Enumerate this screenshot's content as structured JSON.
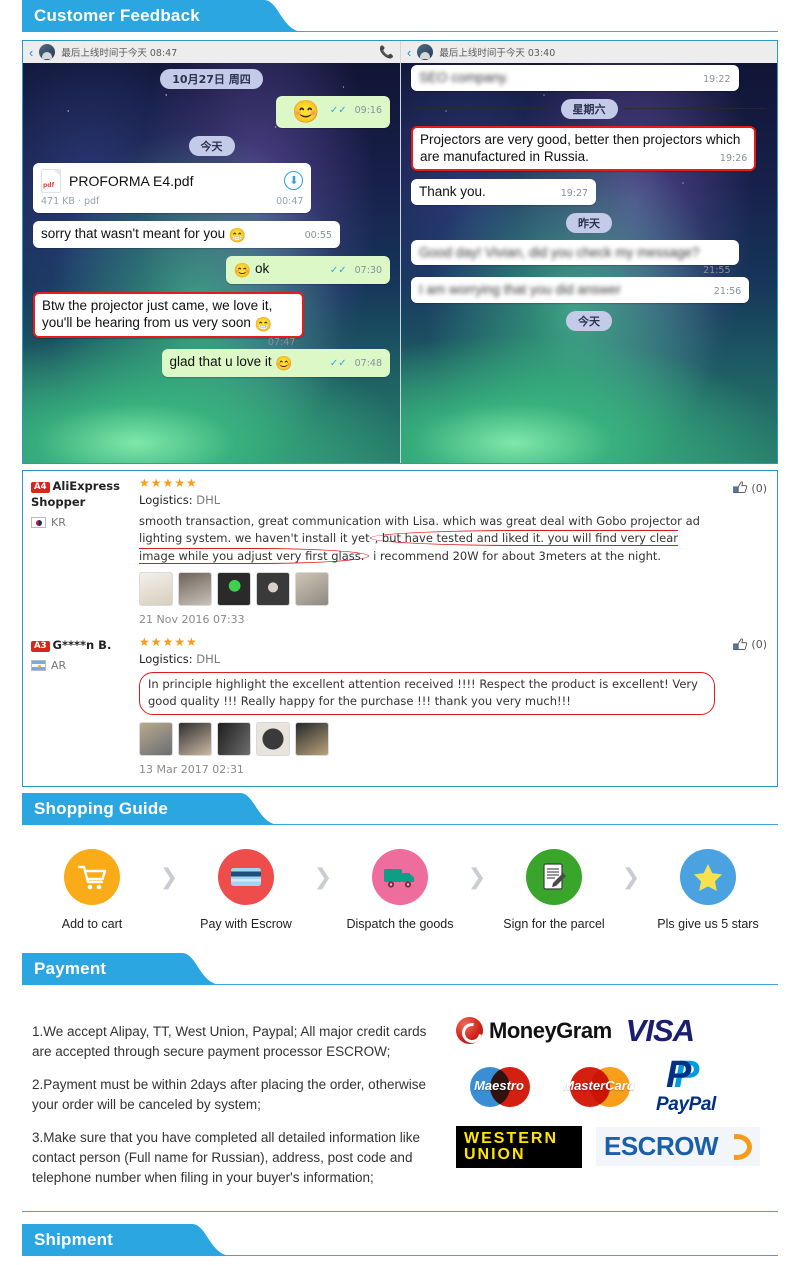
{
  "sections": {
    "customer_feedback": "Customer Feedback",
    "shopping_guide": "Shopping Guide",
    "payment": "Payment",
    "shipment": "Shipment"
  },
  "colors": {
    "banner_blue": "#2ba6e0",
    "border_blue": "#2a9ac4",
    "highlight_red": "#e01b1b",
    "star_orange": "#f79d16"
  },
  "chat": {
    "left": {
      "status": "最后上线时间于今天 08:47",
      "daypills": [
        "10月27日 周四",
        "今天"
      ],
      "messages": [
        {
          "side": "out",
          "text": "",
          "emoji": "😊",
          "time": "09:16",
          "ticks": "✓✓"
        },
        {
          "side": "in",
          "type": "file",
          "filename": "PROFORMA E4.pdf",
          "filemeta": "471 KB · pdf",
          "time": "00:47",
          "icon": "pdf-icon",
          "download": "download-icon"
        },
        {
          "side": "in",
          "text": "sorry that wasn't meant for you",
          "emoji": "😁",
          "time": "00:55"
        },
        {
          "side": "out",
          "text": "ok",
          "emoji": "😊",
          "time": "07:30",
          "ticks": "✓✓"
        },
        {
          "side": "in",
          "text": "Btw the projector just came, we love it, you'll be hearing from us very soon",
          "emoji": "😁",
          "time": "07:47",
          "highlight": true
        },
        {
          "side": "out",
          "text": "glad that u love it",
          "emoji": "😊",
          "time": "07:48",
          "ticks": "✓✓"
        }
      ]
    },
    "right": {
      "status": "最后上线时间于今天 03:40",
      "messages": [
        {
          "side": "in",
          "text": "SEO company.",
          "time": "19:22",
          "blurred": true
        },
        {
          "side": "divider",
          "text": "星期六"
        },
        {
          "side": "in",
          "text": "Projectors  are very good, better then projectors which are manufactured in Russia.",
          "time": "19:26",
          "highlight": true
        },
        {
          "side": "in",
          "text": "Thank you.",
          "time": "19:27"
        },
        {
          "side": "daypill",
          "text": "昨天"
        },
        {
          "side": "in",
          "text": "Good day! Vivian, did you check my message?",
          "time": "21:55",
          "blurred": true
        },
        {
          "side": "in",
          "text": "I am worrying that you did answer",
          "time": "21:56",
          "blurred": true
        },
        {
          "side": "daypill",
          "text": "今天"
        }
      ]
    }
  },
  "reviews": [
    {
      "badge": "A4",
      "name": "AliExpress Shopper",
      "country": "KR",
      "flag": "flag-kr-icon",
      "stars": "★★★★★",
      "logistics_label": "Logistics:",
      "logistics_value": "DHL",
      "text": "smooth transaction, great communication with Lisa. which was great deal with Gobo projector ad lighting system. we haven't install it yet, but have tested and liked it. you will find very clear image while you adjust very first glass. i recommend 20W for about 3meters at the night.",
      "highlight_phrase": ", but have tested and liked it. you will find very clear image while you adjust very first glass.",
      "date": "21 Nov 2016 07:33",
      "likes": "(0)",
      "like_icon": "thumbs-up-icon",
      "thumb_count": 5
    },
    {
      "badge": "A3",
      "name": "G****n B.",
      "country": "AR",
      "flag": "flag-ar-icon",
      "stars": "★★★★★",
      "logistics_label": "Logistics:",
      "logistics_value": "DHL",
      "text": "In principle highlight the excellent attention received !!!! Respect the product is excellent! Very good quality !!! Really happy for the purchase !!! thank you very much!!!",
      "date": "13 Mar 2017 02:31",
      "likes": "(0)",
      "like_icon": "thumbs-up-icon",
      "thumb_count": 5
    }
  ],
  "guide_steps": [
    {
      "label": "Add to cart",
      "icon": "shopping-cart-icon",
      "color": "#f9ac18"
    },
    {
      "label": "Pay with Escrow",
      "icon": "credit-card-icon",
      "color": "#ef4c4c"
    },
    {
      "label": "Dispatch the goods",
      "icon": "delivery-truck-icon",
      "color": "#ef6d9c"
    },
    {
      "label": "Sign for the parcel",
      "icon": "sign-document-icon",
      "color": "#3aa52b"
    },
    {
      "label": "Pls give us 5 stars",
      "icon": "star-icon",
      "color": "#4aa3e0"
    }
  ],
  "guide_arrow": "❯",
  "payment_paragraphs": [
    "1.We accept Alipay, TT, West Union, Paypal; All major credit cards are accepted through secure payment processor ESCROW;",
    "2.Payment must be within 2days after placing the order, otherwise your order will be canceled by system;",
    "3.Make sure that you have completed all detailed information like contact person (Full name for Russian), address, post code and telephone number when filing in your buyer's information;"
  ],
  "payment_logos": [
    {
      "name": "moneygram-logo",
      "text": "MoneyGram"
    },
    {
      "name": "visa-logo",
      "text": "VISA"
    },
    {
      "name": "maestro-logo",
      "text": "Maestro"
    },
    {
      "name": "mastercard-logo",
      "text": "MasterCard"
    },
    {
      "name": "paypal-logo",
      "text": "PayPal"
    },
    {
      "name": "western-union-logo",
      "text_line1": "WESTERN",
      "text_line2": "UNION"
    },
    {
      "name": "escrow-logo",
      "text": "ESCROW"
    }
  ]
}
